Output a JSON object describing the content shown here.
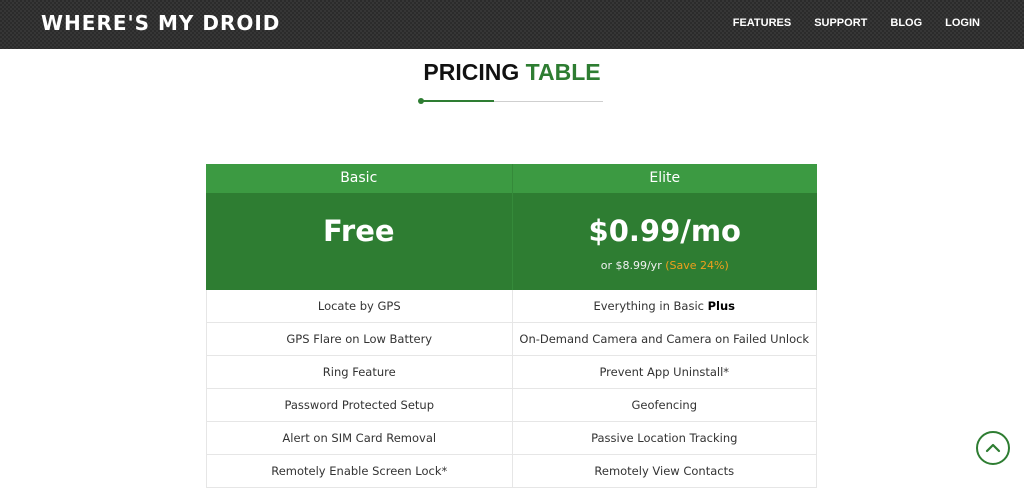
{
  "header": {
    "logo": "WHERE'S MY DROID",
    "nav": [
      "FEATURES",
      "SUPPORT",
      "BLOG",
      "LOGIN"
    ]
  },
  "heading": {
    "part1": "PRICING",
    "part2": "TABLE"
  },
  "plans": [
    {
      "name": "Basic",
      "price": "Free"
    },
    {
      "name": "Elite",
      "price": "$0.99/mo",
      "alt_price": "or $8.99/yr",
      "save": "(Save 24%)"
    }
  ],
  "features": [
    {
      "basic": "Locate by GPS",
      "elite": "Everything in Basic",
      "elite_bold": "Plus"
    },
    {
      "basic": "GPS Flare on Low Battery",
      "elite": "On-Demand Camera and Camera on Failed Unlock"
    },
    {
      "basic": "Ring Feature",
      "elite": "Prevent App Uninstall*"
    },
    {
      "basic": "Password Protected Setup",
      "elite": "Geofencing"
    },
    {
      "basic": "Alert on SIM Card Removal",
      "elite": "Passive Location Tracking"
    },
    {
      "basic": "Remotely Enable Screen Lock*",
      "elite": "Remotely View Contacts"
    }
  ],
  "colors": {
    "brand_green": "#2e7d32",
    "header_green": "#3c9a42",
    "save_orange": "#f0a01c",
    "nav_bg": "#2b2b2b"
  },
  "icons": {
    "scroll_top": "chevron-up-icon"
  }
}
